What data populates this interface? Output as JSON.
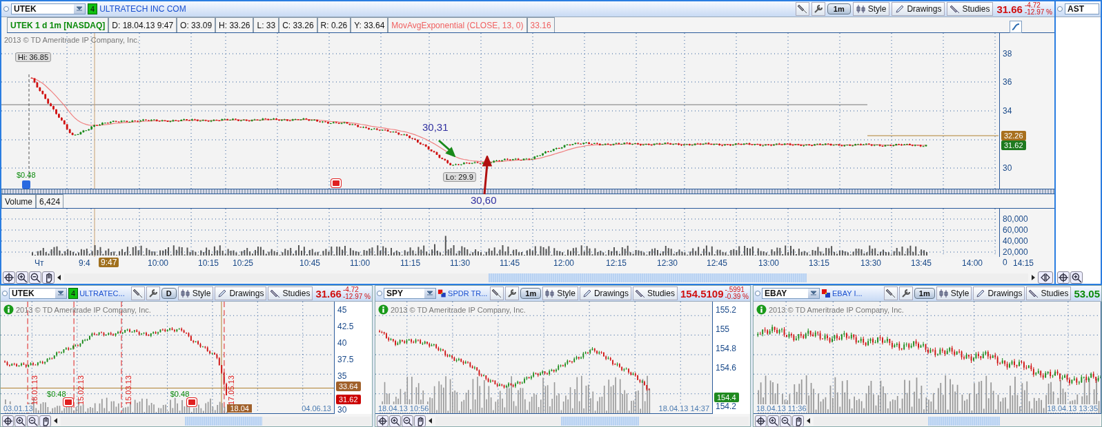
{
  "main": {
    "symbol": "UTEK",
    "badge": "4",
    "company": "ULTRATECH INC COM",
    "period": "1m",
    "tools": [
      "Style",
      "Drawings",
      "Studies"
    ],
    "last": "31.66",
    "rising": false,
    "change": "-4.72",
    "change_pct": "-12.97 %",
    "info": {
      "title": "UTEK 1 d 1m [NASDAQ]",
      "fields": [
        "D: 18.04.13 9:47",
        "O: 33.09",
        "H: 33.26",
        "L: 33",
        "C: 33.26",
        "R: 0.26",
        "Y: 33.64"
      ],
      "study": "MovAvgExponential (CLOSE, 13, 0)",
      "study_value": "33.16"
    },
    "copyright": "2013 © TD Ameritrade IP Company, Inc.",
    "high_label": "Hi: 36.85",
    "low_label": "Lo: 29.9",
    "dividend": "$0.48",
    "price_ticks": [
      "38",
      "36",
      "34",
      "30"
    ],
    "price_tags": [
      {
        "text": "32.26",
        "color": "#a8701e"
      },
      {
        "text": "31.62",
        "color": "#1f7a1f"
      }
    ],
    "annotations": [
      "30,31",
      "30,60"
    ],
    "volume": {
      "label": "Volume",
      "value": "6,424",
      "ticks": [
        "80,000",
        "60,000",
        "40,000",
        "20,000",
        "0"
      ]
    },
    "time_labels": [
      "Чт",
      "9:4",
      "10:00",
      "10:15",
      "10:25",
      "10:45",
      "11:00",
      "11:15",
      "11:30",
      "11:45",
      "12:00",
      "12:15",
      "12:30",
      "12:45",
      "13:00",
      "13:15",
      "13:30",
      "13:45",
      "14:00",
      "14:15"
    ],
    "time_marker": "9:47"
  },
  "side_panel": {
    "symbol": "AST"
  },
  "panels": [
    {
      "symbol": "UTEK",
      "badge": "4",
      "name": "ULTRATEC...",
      "period": "D",
      "tools": [
        "Style",
        "Drawings",
        "Studies"
      ],
      "last": "31.66",
      "rising": false,
      "change": "-4.72",
      "change_pct": "-12.97 %",
      "copyright": "2013 © TD Ameritrade IP Company, Inc.",
      "ticks": [
        "45",
        "42.5",
        "40",
        "37.5",
        "35",
        "30"
      ],
      "tags": [
        {
          "text": "33.64",
          "color": "#a0602a"
        },
        {
          "text": "31.62",
          "color": "#cc0000"
        }
      ],
      "events": [
        "18.01.13",
        "15.02.13",
        "15.03.13",
        "17.05.13"
      ],
      "dividends": [
        "$0.48",
        "$0.48"
      ],
      "date_tag": "18.04",
      "start_label": "03.01.13",
      "end_label": "04.06.13"
    },
    {
      "symbol": "SPY",
      "name": "SPDR TR...",
      "period": "1m",
      "tools": [
        "Style",
        "Drawings",
        "Studies"
      ],
      "last": "154.5109",
      "rising": false,
      "change": "-.5991",
      "change_pct": "-0.39 %",
      "copyright": "2013 © TD Ameritrade IP Company, Inc.",
      "ticks": [
        "155.2",
        "155",
        "154.8",
        "154.6",
        "154.2"
      ],
      "tags": [
        {
          "text": "154.4",
          "color": "#1f8a1f"
        }
      ],
      "start_label": "18.04.13 10:56",
      "end_label": "18.04.13 14:37"
    },
    {
      "symbol": "EBAY",
      "name": "EBAY I...",
      "period": "1m",
      "tools": [
        "Style",
        "Drawings",
        "Studies"
      ],
      "last": "53.05",
      "rising": true,
      "copyright": "2013 © TD Ameritrade IP Company, Inc.",
      "start_label": "18.04.13 11:36",
      "end_label": "18.04.13 13:35"
    }
  ]
}
